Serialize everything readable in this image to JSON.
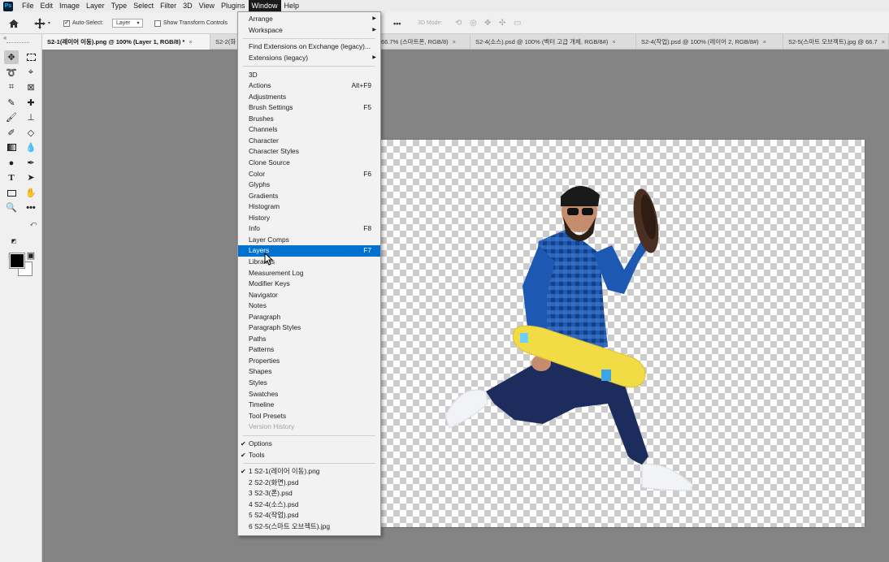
{
  "menubar": {
    "logo": "Ps",
    "items": [
      "File",
      "Edit",
      "Image",
      "Layer",
      "Type",
      "Select",
      "Filter",
      "3D",
      "View",
      "Plugins",
      "Window",
      "Help"
    ],
    "active": "Window"
  },
  "options_bar": {
    "auto_select_label": "Auto-Select:",
    "auto_select_checked": true,
    "auto_select_target": "Layer",
    "transform_controls_label": "Show Transform Controls",
    "transform_controls_checked": false,
    "more_label": "•••",
    "mode_3d_label": "3D Mode:"
  },
  "tabs": [
    {
      "label": "S2-1(레이어 이동).png @ 100% (Layer 1, RGB/8) *",
      "active": true
    },
    {
      "label": "S2-2(화",
      "active": false
    },
    {
      "label": "66.7% (스마트폰, RGB/8)",
      "active": false
    },
    {
      "label": "S2-4(소스).psd @ 100% (벡터 고급 개체, RGB/8#)",
      "active": false
    },
    {
      "label": "S2-4(작업).psd @ 100% (레이어 2, RGB/8#)",
      "active": false
    },
    {
      "label": "S2-5(스마트 오브젝트).jpg @ 66.7",
      "active": false
    }
  ],
  "toolbar": {
    "collapse": "«",
    "icons": [
      "move-icon",
      "marquee-icon",
      "lasso-icon",
      "quick-select-icon",
      "crop-icon",
      "frame-icon",
      "eyedropper-icon",
      "healing-icon",
      "brush-icon",
      "stamp-icon",
      "history-brush-icon",
      "eraser-icon",
      "gradient-icon",
      "blur-icon",
      "dodge-icon",
      "pen-icon",
      "type-icon",
      "path-select-icon",
      "rectangle-icon",
      "hand-icon",
      "zoom-icon",
      "more-tools-icon",
      "quick-mask-icon",
      "screen-mode-icon"
    ],
    "foreground_color": "#000000",
    "background_color": "#ffffff"
  },
  "window_menu": {
    "items": [
      {
        "label": "Arrange",
        "submenu": true
      },
      {
        "label": "Workspace",
        "submenu": true
      },
      {
        "sep": true
      },
      {
        "label": "Find Extensions on Exchange (legacy)..."
      },
      {
        "label": "Extensions (legacy)",
        "submenu": true
      },
      {
        "sep": true
      },
      {
        "label": "3D"
      },
      {
        "label": "Actions",
        "shortcut": "Alt+F9"
      },
      {
        "label": "Adjustments"
      },
      {
        "label": "Brush Settings",
        "shortcut": "F5"
      },
      {
        "label": "Brushes"
      },
      {
        "label": "Channels"
      },
      {
        "label": "Character"
      },
      {
        "label": "Character Styles"
      },
      {
        "label": "Clone Source"
      },
      {
        "label": "Color",
        "shortcut": "F6"
      },
      {
        "label": "Glyphs"
      },
      {
        "label": "Gradients"
      },
      {
        "label": "Histogram"
      },
      {
        "label": "History"
      },
      {
        "label": "Info",
        "shortcut": "F8"
      },
      {
        "label": "Layer Comps"
      },
      {
        "label": "Layers",
        "shortcut": "F7",
        "highlighted": true
      },
      {
        "label": "Libraries"
      },
      {
        "label": "Measurement Log"
      },
      {
        "label": "Modifier Keys"
      },
      {
        "label": "Navigator"
      },
      {
        "label": "Notes"
      },
      {
        "label": "Paragraph"
      },
      {
        "label": "Paragraph Styles"
      },
      {
        "label": "Paths"
      },
      {
        "label": "Patterns"
      },
      {
        "label": "Properties"
      },
      {
        "label": "Shapes"
      },
      {
        "label": "Styles"
      },
      {
        "label": "Swatches"
      },
      {
        "label": "Timeline"
      },
      {
        "label": "Tool Presets"
      },
      {
        "label": "Version History",
        "disabled": true
      },
      {
        "sep": true
      },
      {
        "label": "Options",
        "checked": true
      },
      {
        "label": "Tools",
        "checked": true
      },
      {
        "sep": true
      },
      {
        "label": "1 S2-1(레이어 이동).png",
        "checked": true
      },
      {
        "label": "2 S2-2(화면).psd"
      },
      {
        "label": "3 S2-3(폰).psd"
      },
      {
        "label": "4 S2-4(소스).psd"
      },
      {
        "label": "5 S2-4(작업).psd"
      },
      {
        "label": "6 S2-5(스마트 오브젝트).jpg"
      }
    ]
  },
  "colors": {
    "menu_highlight": "#0071d1",
    "app_background": "#848484",
    "panel_background": "#f0f0f0"
  }
}
